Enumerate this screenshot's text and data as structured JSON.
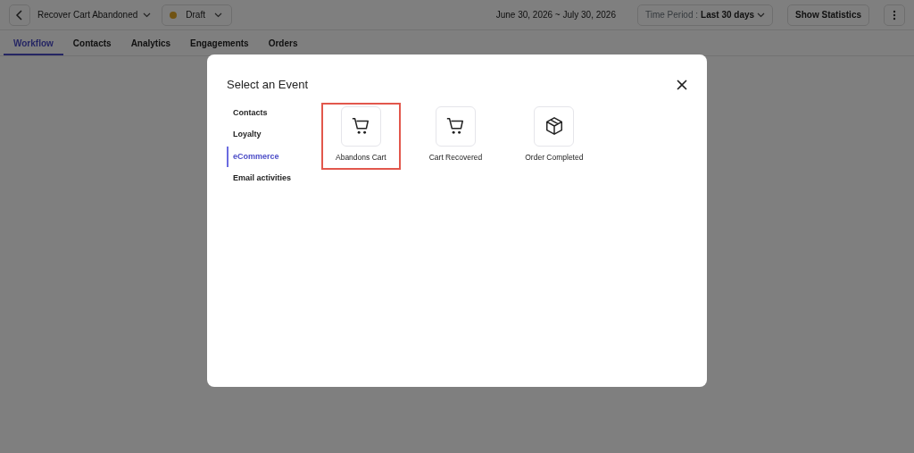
{
  "header": {
    "workflow_name": "Recover Cart Abandoned",
    "status": {
      "label": "Draft",
      "color": "#705313"
    },
    "date_range": "June 30, 2026 ~ July 30, 2026",
    "time_period": {
      "label": "Time Period :",
      "value": "Last 30 days"
    },
    "statistics_button": "Show Statistics"
  },
  "tabs": [
    {
      "label": "Workflow",
      "selected": true
    },
    {
      "label": "Contacts",
      "selected": false
    },
    {
      "label": "Analytics",
      "selected": false
    },
    {
      "label": "Engagements",
      "selected": false
    },
    {
      "label": "Orders",
      "selected": false
    }
  ],
  "modal": {
    "title": "Select an Event",
    "categories": [
      {
        "label": "Contacts",
        "selected": false
      },
      {
        "label": "Loyalty",
        "selected": false
      },
      {
        "label": "eCommerce",
        "selected": true
      },
      {
        "label": "Email activities",
        "selected": false
      }
    ],
    "events": [
      {
        "label": "Abandons Cart",
        "kind": "cart",
        "selected": true
      },
      {
        "label": "Cart Recovered",
        "kind": "cart",
        "selected": false
      },
      {
        "label": "Order Completed",
        "kind": "box",
        "selected": false
      }
    ]
  }
}
